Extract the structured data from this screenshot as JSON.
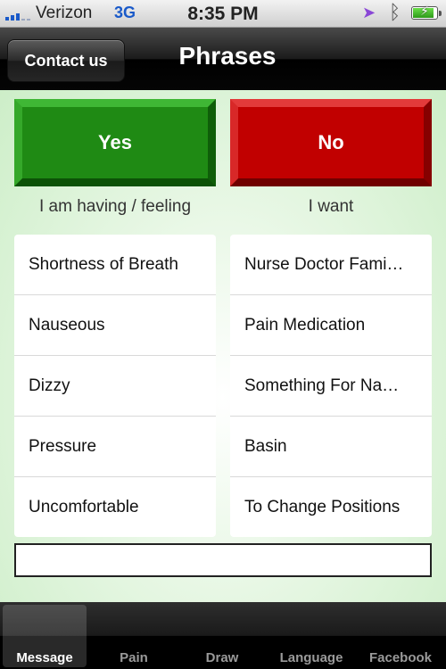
{
  "status_bar": {
    "carrier": "Verizon",
    "network": "3G",
    "time": "8:35 PM",
    "location_icon": "location-arrow-icon",
    "bluetooth_icon": "bluetooth-icon",
    "battery_icon": "battery-charging-icon",
    "battery_level": 0.9
  },
  "nav": {
    "back_label": "Contact us",
    "title": "Phrases"
  },
  "buttons": {
    "yes_label": "Yes",
    "no_label": "No",
    "yes_color": "#1f8a14",
    "no_color": "#c10000"
  },
  "columns": {
    "left_label": "I am having / feeling",
    "right_label": "I want"
  },
  "left_items": [
    "Shortness of Breath",
    "Nauseous",
    "Dizzy",
    "Pressure",
    "Uncomfortable"
  ],
  "right_items": [
    "Nurse Doctor Fami…",
    "Pain Medication",
    "Something For Na…",
    "Basin",
    "To Change Positions"
  ],
  "message": {
    "value": ""
  },
  "tabs": [
    "Message",
    "Pain",
    "Draw",
    "Language",
    "Facebook"
  ],
  "active_tab": "Message"
}
